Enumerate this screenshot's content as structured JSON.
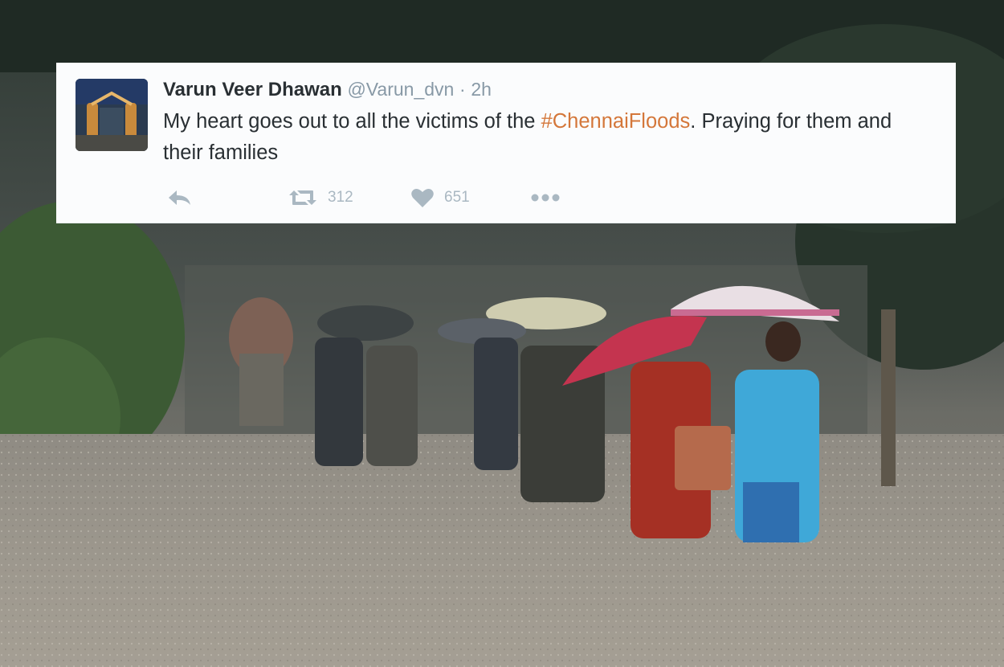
{
  "tweet": {
    "display_name": "Varun Veer Dhawan",
    "handle": "@Varun_dvn",
    "separator": "·",
    "time": "2h",
    "text_before": "My heart goes out to all the victims of the ",
    "hashtag": "#ChennaiFloods",
    "text_after": ". Praying for them and their families",
    "retweet_count": "312",
    "like_count": "651"
  },
  "icons": {
    "reply": "reply-icon",
    "retweet": "retweet-icon",
    "like": "heart-icon",
    "more": "more-dots-icon"
  },
  "colors": {
    "card_background": "#fbfcfd",
    "name": "#292f33",
    "muted": "#8899a6",
    "hashtag": "#d4773a",
    "action_icons": "#aab8c2"
  }
}
